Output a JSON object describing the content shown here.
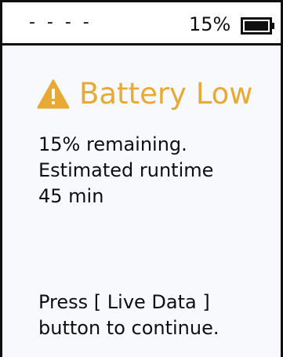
{
  "theme": {
    "accent": "#e8a935",
    "text": "#0f0f0f",
    "background": "#f7f9fc"
  },
  "status_bar": {
    "left_text": "- - - -",
    "battery_percent_text": "15%",
    "battery_level": 0.15,
    "battery_icon": "battery-icon"
  },
  "alert": {
    "icon": "warning-icon",
    "title": "Battery Low"
  },
  "message": {
    "lines": [
      "15% remaining.",
      "Estimated runtime",
      "45 min"
    ]
  },
  "instruction": {
    "lines": [
      "Press [ Live Data ]",
      "button to continue."
    ]
  }
}
